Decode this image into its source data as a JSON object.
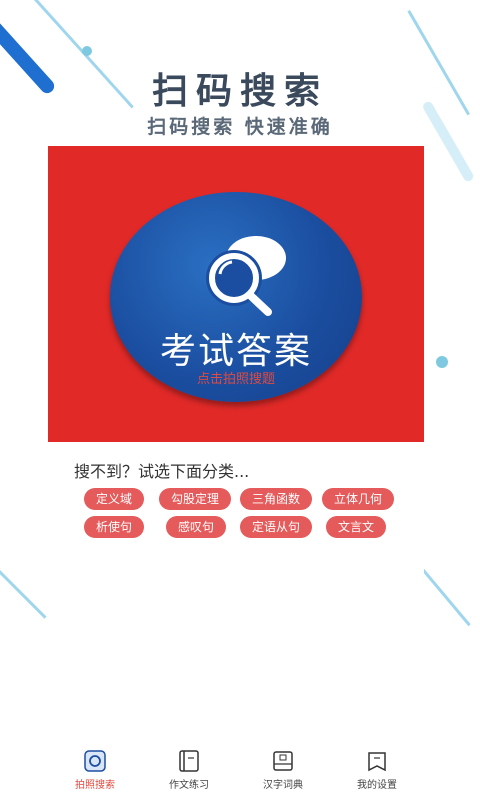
{
  "header": {
    "title": "扫码搜索",
    "subtitle": "扫码搜索 快速准确"
  },
  "banner": {
    "logo_text": "考试答案",
    "hint": "点击拍照搜题"
  },
  "categories": {
    "prompt": "搜不到？试选下面分类...",
    "items": [
      "定义域",
      "勾股定理",
      "三角函数",
      "立体几何",
      "析使句",
      "感叹句",
      "定语从句",
      "文言文"
    ]
  },
  "tabs": [
    {
      "label": "拍照搜索",
      "icon": "camera-search-icon",
      "active": true
    },
    {
      "label": "作文练习",
      "icon": "notebook-icon",
      "active": false
    },
    {
      "label": "汉字词典",
      "icon": "dictionary-icon",
      "active": false
    },
    {
      "label": "我的设置",
      "icon": "settings-book-icon",
      "active": false
    }
  ],
  "colors": {
    "banner_red": "#e12a28",
    "circle_blue": "#1b4ea0",
    "chip_red": "#e55a5a",
    "accent": "#e04a40"
  }
}
